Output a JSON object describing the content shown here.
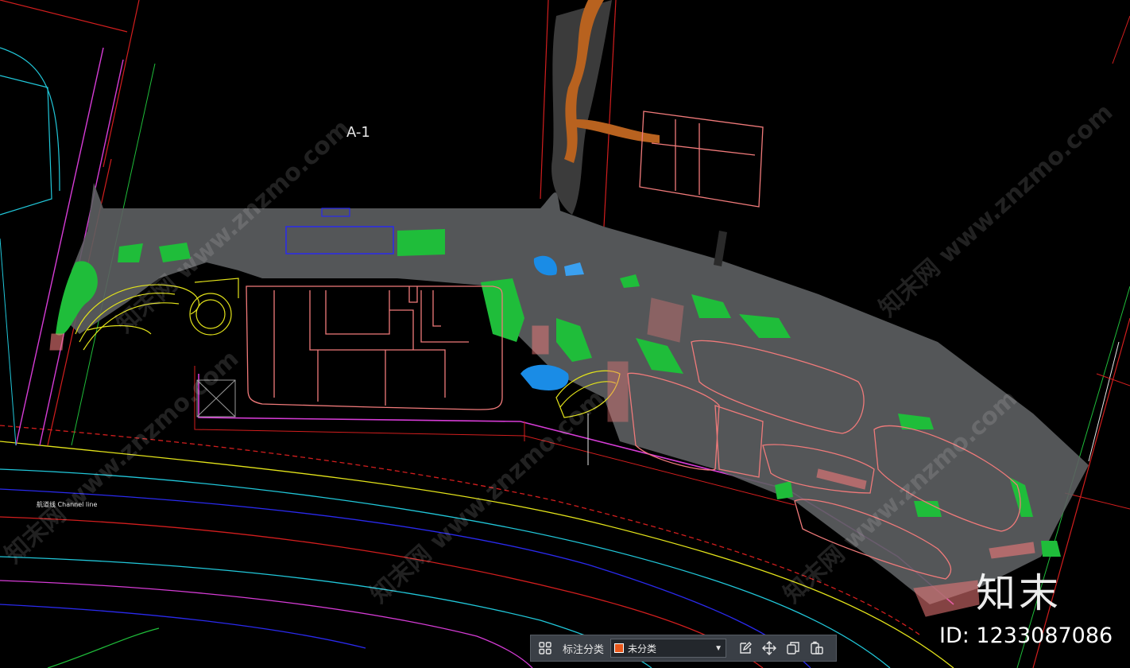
{
  "drawing": {
    "parcel_label": "A-1",
    "channel_label": "航道线 Channel line"
  },
  "brand": {
    "logo_text": "知末",
    "id_text": "ID: 1233087086"
  },
  "watermark": {
    "text": "知末网 www.znzmo.com"
  },
  "toolbar": {
    "category_label": "标注分类",
    "selected_value": "未分类",
    "selected_color": "#e8581c",
    "icons": [
      "grid-icon",
      "edit-icon",
      "move-icon",
      "copy-icon",
      "paste-icon"
    ]
  },
  "colors": {
    "background": "#000000",
    "boundary": "#d21e1e",
    "magenta": "#d63cd6",
    "cyan": "#21c7d9",
    "green": "#1fbd3a",
    "pink": "#f07a7a",
    "yellow": "#e3e31a",
    "plaza": "#6b6b6b",
    "terrain": "#b8621f"
  }
}
